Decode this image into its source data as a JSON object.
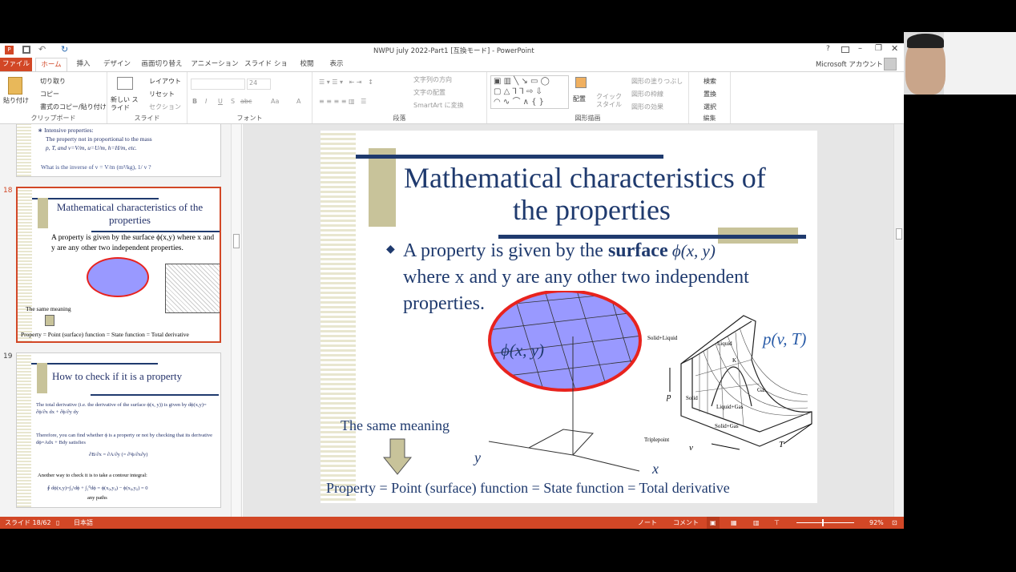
{
  "window": {
    "title": "NWPU july 2022-Part1 [互換モード] - PowerPoint",
    "account": "Microsoft アカウント",
    "help": "?"
  },
  "tabs": [
    "ファイル",
    "ホーム",
    "挿入",
    "デザイン",
    "画面切り替え",
    "アニメーション",
    "スライド ショー",
    "校閲",
    "表示"
  ],
  "ribbon": {
    "clipboard": {
      "label": "クリップボード",
      "paste": "貼り付け",
      "cut": "切り取り",
      "copy": "コピー",
      "format_painter": "書式のコピー/貼り付け"
    },
    "slides": {
      "label": "スライド",
      "new_slide": "新しい スライド",
      "layout": "レイアウト",
      "reset": "リセット",
      "section": "セクション"
    },
    "font": {
      "label": "フォント",
      "size": "24",
      "bold": "B",
      "italic": "I",
      "underline": "U",
      "shadow": "S",
      "strike": "abc",
      "case": "Aa",
      "color": "A"
    },
    "paragraph": {
      "label": "段落",
      "text_direction": "文字列の方向",
      "align_text": "文字の配置",
      "smartart": "SmartArt に変換"
    },
    "drawing": {
      "label": "図形描画",
      "arrange": "配置",
      "quick_styles": "クイック スタイル",
      "fill": "図形の塗りつぶし",
      "outline": "図形の枠線",
      "effects": "図形の効果"
    },
    "editing": {
      "label": "編集",
      "find": "検索",
      "replace": "置換",
      "select": "選択"
    }
  },
  "thumbnails": [
    {
      "lines": [
        "∗ Intensive properties:",
        "The property not in proportional to the mass",
        "p, T, and v=V/m, u=U/m, h=H/m, etc.",
        "What is the inverse of v = V/m  (m³/kg), 1/ v ?"
      ]
    },
    {
      "number": "18",
      "title": "Mathematical characteristics of the properties",
      "bullet": "A property is given by the surface ϕ(x,y) where x and y are any other two independent properties.",
      "same": "The same meaning",
      "footer": "Property = Point (surface) function = State function = Total derivative"
    },
    {
      "number": "19",
      "title": "How to check if it is a property",
      "l1": "The total derivative (i.e. the derivative of the surface ϕ(x, y)) is given by  dϕ(x,y)= ∂ϕ/∂x dx + ∂ϕ/∂y dy",
      "l2": "Therefore, you can find whether ϕ is a property or not by checking that its derivative  dϕ=Adx + Bdy  satisfies",
      "l3": "∂B/∂x = ∂A/∂y (= ∂²ϕ/∂x∂y)",
      "l4": "Another way to check it is to take a contour integral:",
      "l5": "∮ dϕ(x,y)=∫₀¹dϕ + ∫₁⁰dϕ = ϕ(x₀,y₀) − ϕ(x₀,y₀) = 0",
      "l6": "any paths"
    }
  ],
  "slide": {
    "title_line1": "Mathematical characteristics of",
    "title_line2": "the properties",
    "bullet_pre": "A property is given by the ",
    "bullet_bold": "surface",
    "bullet_math": " ϕ(x, y)",
    "bullet_line2": "where x and y are any other two independent",
    "bullet_line3": "properties.",
    "phi_label": "ϕ(x, y)",
    "axis_x": "x",
    "axis_y": "y",
    "pvt_label": "p(v, T)",
    "diagram_labels": [
      "Solid+Liquid",
      "Liquid",
      "K",
      "Gas",
      "Solid",
      "Liquid+Gas",
      "Solid+Gas",
      "Triplepoint",
      "p",
      "v",
      "T"
    ],
    "same_meaning": "The same meaning",
    "footer": "Property = Point (surface) function = State function = Total derivative"
  },
  "status": {
    "slide": "スライド 18/62",
    "language": "日本語",
    "notes": "ノート",
    "comments": "コメント",
    "zoom": "92%"
  },
  "colors": {
    "accent": "#d24726",
    "slide_text": "#1f3a6e",
    "olive": "#c8c39a",
    "ellipse_fill": "#9999ff",
    "ellipse_border": "#e8231e"
  }
}
